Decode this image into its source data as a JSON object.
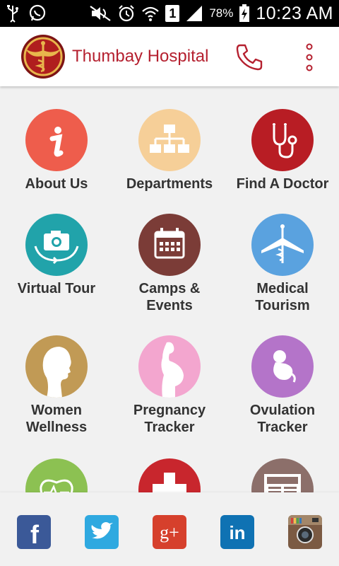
{
  "status_bar": {
    "battery_percent": "78%",
    "time": "10:23 AM",
    "sim_number": "1",
    "icons": [
      "usb-icon",
      "whatsapp-icon",
      "mute-icon",
      "alarm-icon",
      "wifi-icon",
      "sim-icon",
      "signal-icon",
      "battery-charging-icon"
    ]
  },
  "app_bar": {
    "title": "Thumbay Hospital",
    "colors": {
      "title": "#b5202f",
      "phone": "#b5202f",
      "more": "#b5202f"
    }
  },
  "menu": [
    {
      "label": "About Us",
      "icon": "info-icon",
      "color": "#ee5d4c"
    },
    {
      "label": "Departments",
      "icon": "sitemap-icon",
      "color": "#f6cf98"
    },
    {
      "label": "Find A Doctor",
      "icon": "stethoscope-icon",
      "color": "#b81d24"
    },
    {
      "label": "Virtual Tour",
      "icon": "camera-360-icon",
      "color": "#21a3aa"
    },
    {
      "label": "Camps & Events",
      "icon": "calendar-icon",
      "color": "#7b3c37"
    },
    {
      "label": "Medical Tourism",
      "icon": "plane-caduceus-icon",
      "color": "#5aa2df"
    },
    {
      "label": "Women Wellness",
      "icon": "woman-profile-icon",
      "color": "#c19a55"
    },
    {
      "label": "Pregnancy Tracker",
      "icon": "pregnant-woman-icon",
      "color": "#f3a6cf"
    },
    {
      "label": "Ovulation Tracker",
      "icon": "fetus-icon",
      "color": "#b474c9"
    },
    {
      "label": "",
      "icon": "heartbeat-icon",
      "color": "#8cc152"
    },
    {
      "label": "",
      "icon": "red-cross-icon",
      "color": "#c8262d"
    },
    {
      "label": "",
      "icon": "news-icon",
      "color": "#8c6f6a"
    }
  ],
  "social": [
    {
      "name": "facebook",
      "icon": "facebook-icon",
      "color": "#3b5998",
      "glyph": "f"
    },
    {
      "name": "twitter",
      "icon": "twitter-icon",
      "color": "#2fa9e0"
    },
    {
      "name": "google-plus",
      "icon": "google-plus-icon",
      "color": "#d6402c",
      "glyph": "g+"
    },
    {
      "name": "linkedin",
      "icon": "linkedin-icon",
      "color": "#0f72b3",
      "glyph": "in"
    },
    {
      "name": "instagram",
      "icon": "instagram-icon",
      "color": "#7b5a43"
    }
  ]
}
